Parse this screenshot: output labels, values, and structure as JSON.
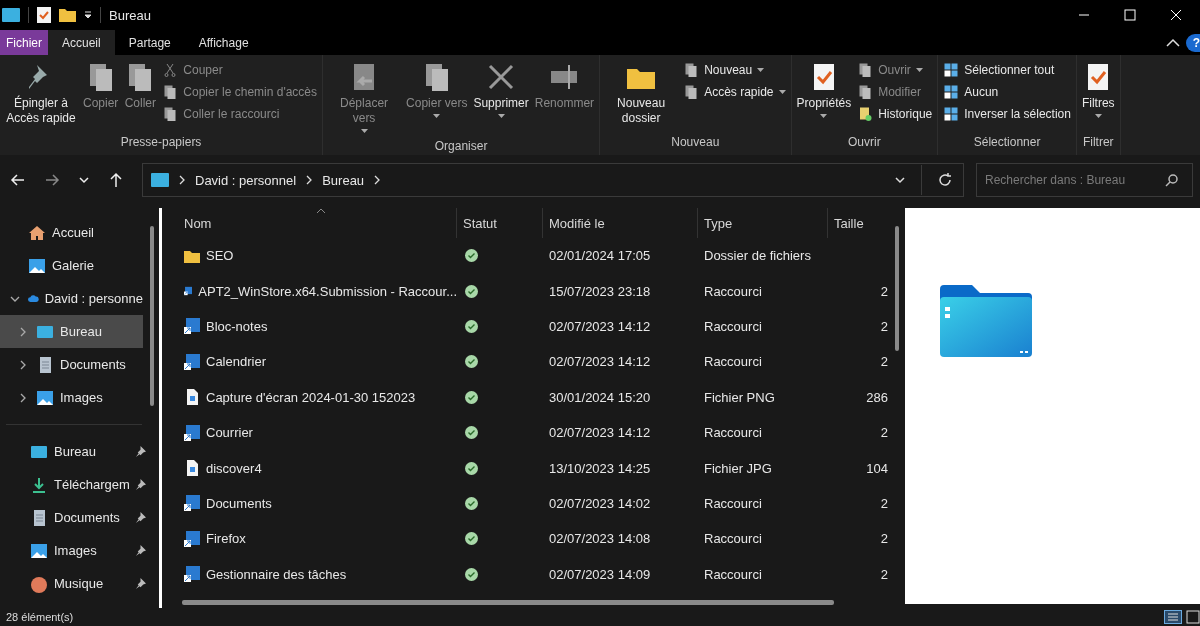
{
  "window": {
    "title": "Bureau",
    "help": "?"
  },
  "ribbon_tabs": [
    {
      "label": "Fichier",
      "kind": "file",
      "selected": false
    },
    {
      "label": "Accueil",
      "kind": "tab",
      "selected": true
    },
    {
      "label": "Partage",
      "kind": "tab",
      "selected": false
    },
    {
      "label": "Affichage",
      "kind": "tab",
      "selected": false
    }
  ],
  "ribbon": {
    "groups": [
      {
        "label": "Presse-papiers",
        "items": [
          {
            "label": "Épingler à Accès rapide",
            "kind": "large",
            "disabled": false,
            "dropdown": false
          },
          {
            "label": "Copier",
            "kind": "large",
            "disabled": true,
            "dropdown": false
          },
          {
            "label": "Coller",
            "kind": "large",
            "disabled": true,
            "dropdown": false
          },
          {
            "label": "Couper",
            "kind": "small",
            "disabled": true,
            "dropdown": false
          },
          {
            "label": "Copier le chemin d'accès",
            "kind": "small",
            "disabled": true,
            "dropdown": false
          },
          {
            "label": "Coller le raccourci",
            "kind": "small",
            "disabled": true,
            "dropdown": false
          }
        ]
      },
      {
        "label": "Organiser",
        "items": [
          {
            "label": "Déplacer vers",
            "kind": "large",
            "disabled": true,
            "dropdown": true
          },
          {
            "label": "Copier vers",
            "kind": "large",
            "disabled": true,
            "dropdown": true
          },
          {
            "label": "Supprimer",
            "kind": "large",
            "disabled": false,
            "dropdown": true
          },
          {
            "label": "Renommer",
            "kind": "large",
            "disabled": true,
            "dropdown": false
          }
        ]
      },
      {
        "label": "Nouveau",
        "items": [
          {
            "label": "Nouveau dossier",
            "kind": "large",
            "disabled": false,
            "dropdown": false
          },
          {
            "label": "Nouveau",
            "kind": "small",
            "disabled": false,
            "dropdown": true
          },
          {
            "label": "Accès rapide",
            "kind": "small",
            "disabled": false,
            "dropdown": true
          }
        ]
      },
      {
        "label": "Ouvrir",
        "items": [
          {
            "label": "Propriétés",
            "kind": "large",
            "disabled": false,
            "dropdown": true
          },
          {
            "label": "Ouvrir",
            "kind": "small",
            "disabled": true,
            "dropdown": true
          },
          {
            "label": "Modifier",
            "kind": "small",
            "disabled": true,
            "dropdown": false
          },
          {
            "label": "Historique",
            "kind": "small",
            "disabled": false,
            "dropdown": false
          }
        ]
      },
      {
        "label": "Sélectionner",
        "items": [
          {
            "label": "Sélectionner tout",
            "kind": "small",
            "disabled": false,
            "dropdown": false
          },
          {
            "label": "Aucun",
            "kind": "small",
            "disabled": false,
            "dropdown": false
          },
          {
            "label": "Inverser la sélection",
            "kind": "small",
            "disabled": false,
            "dropdown": false
          }
        ]
      },
      {
        "label": "Filtrer",
        "items": [
          {
            "label": "Filtres",
            "kind": "large",
            "disabled": false,
            "dropdown": true
          }
        ]
      }
    ]
  },
  "navigation": {
    "forward_disabled": true,
    "breadcrumbs": [
      "David : personnel",
      "Bureau"
    ],
    "search": {
      "placeholder": "Rechercher dans : Bureau"
    }
  },
  "sidebar": {
    "items": [
      {
        "label": "Accueil",
        "selected": false
      },
      {
        "label": "Galerie",
        "selected": false
      },
      {
        "label": "David : personne",
        "selected": false,
        "expanded": true,
        "children": [
          {
            "label": "Bureau",
            "selected": true,
            "expanded": false
          },
          {
            "label": "Documents",
            "selected": false,
            "expanded": false
          },
          {
            "label": "Images",
            "selected": false,
            "expanded": false
          }
        ]
      }
    ],
    "pinned": [
      {
        "label": "Bureau",
        "pinned": true
      },
      {
        "label": "Téléchargem",
        "pinned": true
      },
      {
        "label": "Documents",
        "pinned": true
      },
      {
        "label": "Images",
        "pinned": true
      },
      {
        "label": "Musique",
        "pinned": true
      }
    ]
  },
  "file_list": {
    "columns": [
      "Nom",
      "Statut",
      "Modifié le",
      "Type",
      "Taille"
    ],
    "rows": [
      {
        "name": "SEO",
        "kind": "folder",
        "synced": true,
        "modified": "02/01/2024 17:05",
        "type": "Dossier de fichiers",
        "size": "",
        "selected": false
      },
      {
        "name": "APT2_WinStore.x64.Submission - Raccour...",
        "kind": "shortcut",
        "synced": true,
        "modified": "15/07/2023 23:18",
        "type": "Raccourci",
        "size": "2",
        "selected": false
      },
      {
        "name": "Bloc-notes",
        "kind": "shortcut",
        "synced": true,
        "modified": "02/07/2023 14:12",
        "type": "Raccourci",
        "size": "2",
        "selected": false
      },
      {
        "name": "Calendrier",
        "kind": "shortcut",
        "synced": true,
        "modified": "02/07/2023 14:12",
        "type": "Raccourci",
        "size": "2",
        "selected": false
      },
      {
        "name": "Capture d'écran 2024-01-30 152023",
        "kind": "image",
        "synced": true,
        "modified": "30/01/2024 15:20",
        "type": "Fichier PNG",
        "size": "286",
        "selected": false
      },
      {
        "name": "Courrier",
        "kind": "shortcut",
        "synced": true,
        "modified": "02/07/2023 14:12",
        "type": "Raccourci",
        "size": "2",
        "selected": false
      },
      {
        "name": "discover4",
        "kind": "image",
        "synced": true,
        "modified": "13/10/2023 14:25",
        "type": "Fichier JPG",
        "size": "104",
        "selected": false
      },
      {
        "name": "Documents",
        "kind": "shortcut",
        "synced": true,
        "modified": "02/07/2023 14:02",
        "type": "Raccourci",
        "size": "2",
        "selected": false
      },
      {
        "name": "Firefox",
        "kind": "shortcut",
        "synced": true,
        "modified": "02/07/2023 14:08",
        "type": "Raccourci",
        "size": "2",
        "selected": false
      },
      {
        "name": "Gestionnaire des tâches",
        "kind": "shortcut",
        "synced": true,
        "modified": "02/07/2023 14:09",
        "type": "Raccourci",
        "size": "2",
        "selected": false
      }
    ]
  },
  "status_bar": {
    "count": "28 élément(s)"
  }
}
